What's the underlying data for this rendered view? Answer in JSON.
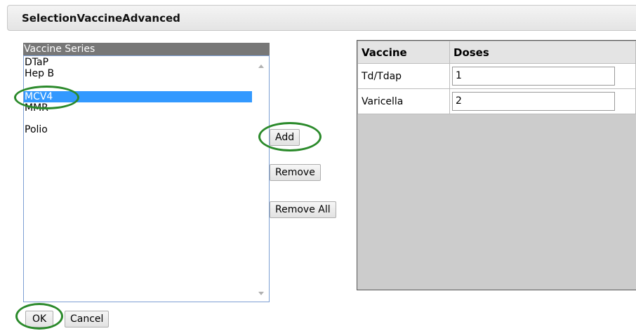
{
  "window": {
    "title": "SelectionVaccineAdvanced"
  },
  "vaccine_series": {
    "header": "Vaccine Series",
    "items": [
      {
        "label": "DTaP",
        "selected": false
      },
      {
        "label": "Hep B",
        "selected": false
      },
      {
        "label": "MCV4",
        "selected": true
      },
      {
        "label": "MMR",
        "selected": false
      },
      {
        "label": "Polio",
        "selected": false
      }
    ]
  },
  "buttons": {
    "add": "Add",
    "remove": "Remove",
    "remove_all": "Remove All",
    "ok": "OK",
    "cancel": "Cancel"
  },
  "grid": {
    "columns": [
      "Vaccine",
      "Doses"
    ],
    "rows": [
      {
        "vaccine": "Td/Tdap",
        "doses": "1"
      },
      {
        "vaccine": "Varicella",
        "doses": "2"
      }
    ]
  },
  "highlight_color": "#2b8a2b",
  "selection_color": "#3399ff"
}
